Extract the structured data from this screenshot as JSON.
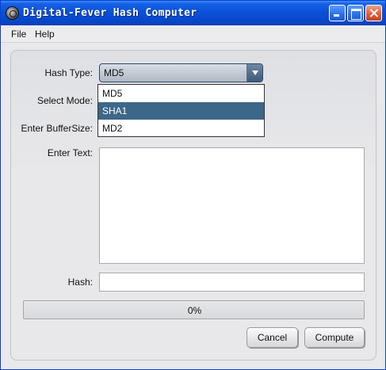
{
  "window": {
    "title": "Digital-Fever Hash Computer"
  },
  "menubar": {
    "items": [
      "File",
      "Help"
    ]
  },
  "form": {
    "hash_type_label": "Hash Type:",
    "hash_type_value": "MD5",
    "hash_type_options": [
      "MD5",
      "SHA1",
      "MD2"
    ],
    "highlighted_option": "SHA1",
    "select_mode_label": "Select Mode:",
    "buffer_size_label": "Enter BufferSize:",
    "enter_text_label": "Enter Text:",
    "enter_text_value": "",
    "hash_label": "Hash:",
    "hash_value": ""
  },
  "progress": {
    "percent": 0,
    "text": "0%"
  },
  "buttons": {
    "cancel": "Cancel",
    "compute": "Compute"
  }
}
